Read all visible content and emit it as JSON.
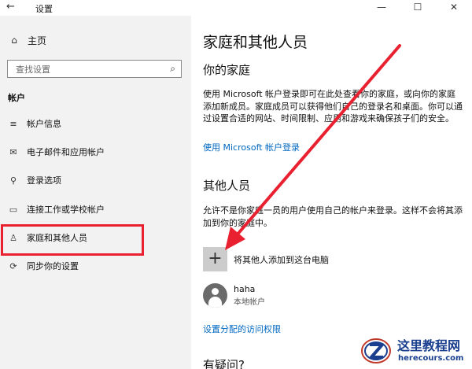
{
  "window": {
    "title": "设置",
    "back_icon": "←",
    "minimize_icon": "—",
    "maximize_icon": "☐",
    "close_icon": "✕"
  },
  "sidebar": {
    "home_label": "主页",
    "home_icon": "⌂",
    "search": {
      "placeholder": "查找设置",
      "icon": "⌕"
    },
    "section": "帐户",
    "items": [
      {
        "label": "帐户信息",
        "icon": "≡"
      },
      {
        "label": "电子邮件和应用帐户",
        "icon": "✉"
      },
      {
        "label": "登录选项",
        "icon": "⚲"
      },
      {
        "label": "连接工作或学校帐户",
        "icon": "▭"
      },
      {
        "label": "家庭和其他人员",
        "icon": "♙"
      },
      {
        "label": "同步你的设置",
        "icon": "⟳"
      }
    ],
    "selected_index": 4
  },
  "main": {
    "title": "家庭和其他人员",
    "family": {
      "heading": "你的家庭",
      "description": "使用 Microsoft 帐户登录即可在此处查看你的家庭，或向你的家庭添加新成员。家庭成员可以获得他们自己的登录名和桌面。你可以通过设置合适的网站、时间限制、应用和游戏来确保孩子们的安全。",
      "signin_link": "使用 Microsoft 帐户登录"
    },
    "others": {
      "heading": "其他人员",
      "description": "允许不是你家庭一员的用户使用自己的帐户来登录。这样不会将其添加到你的家庭中。",
      "add_icon": "+",
      "add_label": "将其他人添加到这台电脑",
      "user": {
        "name": "haha",
        "type": "本地帐户"
      },
      "access_link": "设置分配的访问权限"
    },
    "question_heading": "有疑问?"
  },
  "watermark": {
    "cn": "这里教程网",
    "en": "herecours.com"
  },
  "colors": {
    "accent_link": "#0067c0",
    "highlight": "#e82030",
    "sidebar_bg": "#f2f2f2"
  }
}
